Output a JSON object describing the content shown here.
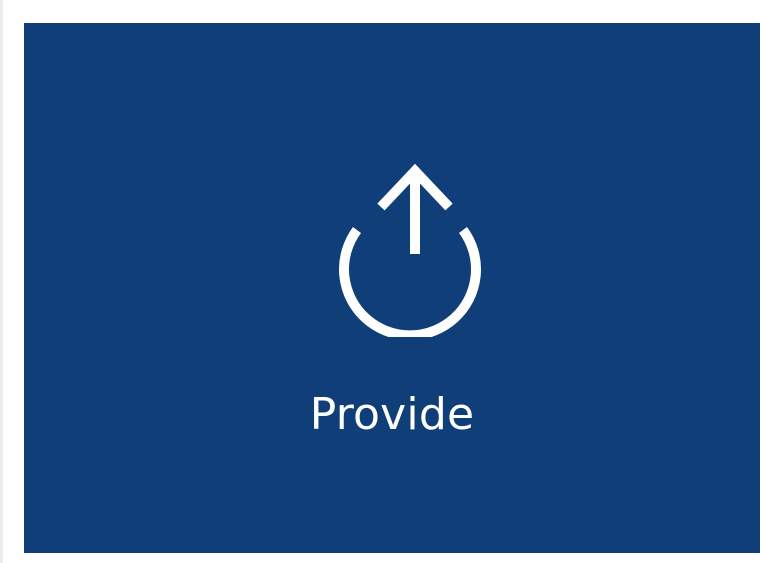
{
  "tile": {
    "label": "Provide",
    "icon": "upload-power-icon",
    "background_color": "#0f3e78",
    "foreground_color": "#ffffff"
  }
}
